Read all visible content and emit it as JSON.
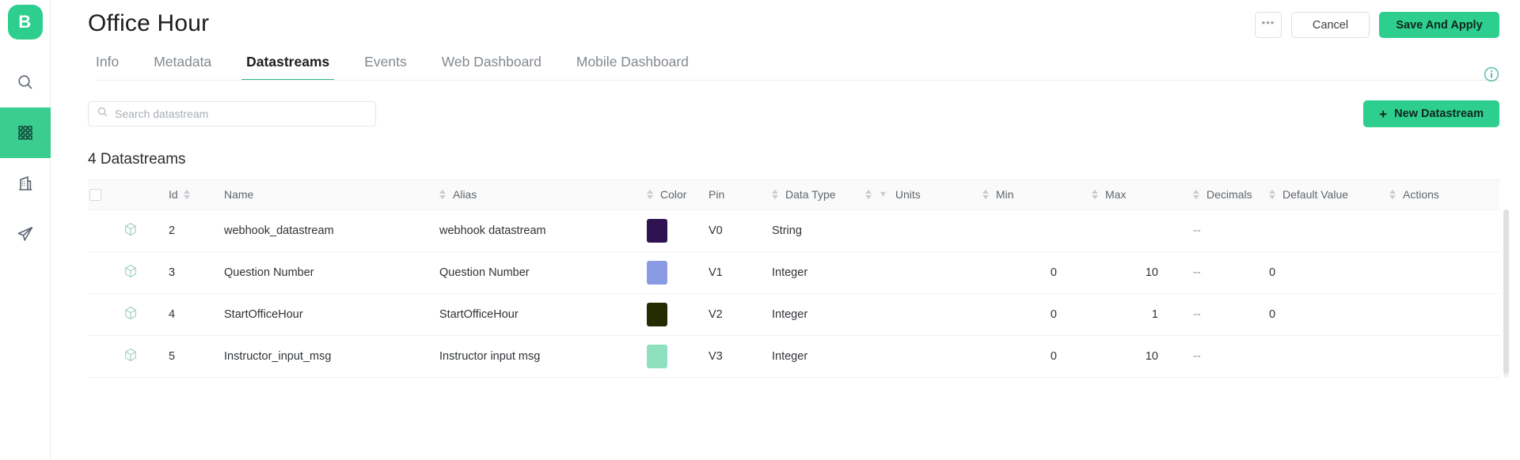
{
  "sidebar": {
    "logo_label": "B",
    "items": [
      {
        "name": "search",
        "icon": "search-icon",
        "active": false
      },
      {
        "name": "apps",
        "icon": "grid-apps-icon",
        "active": true
      },
      {
        "name": "organization",
        "icon": "building-icon",
        "active": false
      },
      {
        "name": "send",
        "icon": "paper-plane-icon",
        "active": false
      }
    ]
  },
  "header": {
    "title": "Office Hour",
    "more_label": "•••",
    "cancel_label": "Cancel",
    "save_label": "Save And Apply",
    "info_icon": "info-circle-icon"
  },
  "tabs": [
    {
      "label": "Info",
      "active": false
    },
    {
      "label": "Metadata",
      "active": false
    },
    {
      "label": "Datastreams",
      "active": true
    },
    {
      "label": "Events",
      "active": false
    },
    {
      "label": "Web Dashboard",
      "active": false
    },
    {
      "label": "Mobile Dashboard",
      "active": false
    }
  ],
  "toolbar": {
    "search_placeholder": "Search datastream",
    "search_value": "",
    "search_icon": "search-icon",
    "new_datastream_label": "New Datastream",
    "new_datastream_plus": "+"
  },
  "table": {
    "count_label": "4 Datastreams",
    "columns": [
      {
        "key": "check",
        "label": "",
        "sortable": false,
        "filter": false
      },
      {
        "key": "icon",
        "label": "",
        "sortable": false,
        "filter": false
      },
      {
        "key": "id",
        "label": "Id",
        "sortable": true,
        "filter": false
      },
      {
        "key": "name",
        "label": "Name",
        "sortable": true,
        "filter": false
      },
      {
        "key": "alias",
        "label": "Alias",
        "sortable": true,
        "filter": false
      },
      {
        "key": "color",
        "label": "Color",
        "sortable": false,
        "filter": false
      },
      {
        "key": "pin",
        "label": "Pin",
        "sortable": true,
        "filter": false
      },
      {
        "key": "type",
        "label": "Data Type",
        "sortable": true,
        "filter": true
      },
      {
        "key": "units",
        "label": "Units",
        "sortable": true,
        "filter": false
      },
      {
        "key": "min",
        "label": "Min",
        "sortable": true,
        "filter": false
      },
      {
        "key": "max",
        "label": "Max",
        "sortable": true,
        "filter": false
      },
      {
        "key": "decimals",
        "label": "Decimals",
        "sortable": true,
        "filter": false
      },
      {
        "key": "default",
        "label": "Default Value",
        "sortable": true,
        "filter": false
      },
      {
        "key": "actions",
        "label": "Actions",
        "sortable": false,
        "filter": false
      }
    ],
    "rows": [
      {
        "id": "2",
        "name": "webhook_datastream",
        "alias": "webhook datastream",
        "color": "#2E1252",
        "pin": "V0",
        "type": "String",
        "units": "",
        "min": "",
        "max": "",
        "decimals": "--",
        "default": ""
      },
      {
        "id": "3",
        "name": "Question Number",
        "alias": "Question Number",
        "color": "#8B9BE3",
        "pin": "V1",
        "type": "Integer",
        "units": "",
        "min": "0",
        "max": "10",
        "decimals": "--",
        "default": "0"
      },
      {
        "id": "4",
        "name": "StartOfficeHour",
        "alias": "StartOfficeHour",
        "color": "#232C01",
        "pin": "V2",
        "type": "Integer",
        "units": "",
        "min": "0",
        "max": "1",
        "decimals": "--",
        "default": "0"
      },
      {
        "id": "5",
        "name": "Instructor_input_msg",
        "alias": "Instructor input msg",
        "color": "#8FE0BE",
        "pin": "V3",
        "type": "Integer",
        "units": "",
        "min": "0",
        "max": "10",
        "decimals": "--",
        "default": ""
      }
    ]
  },
  "colors": {
    "brand_green": "#2ecf8e",
    "tab_underline": "#2bb793",
    "info_icon": "#5bbcb0"
  }
}
